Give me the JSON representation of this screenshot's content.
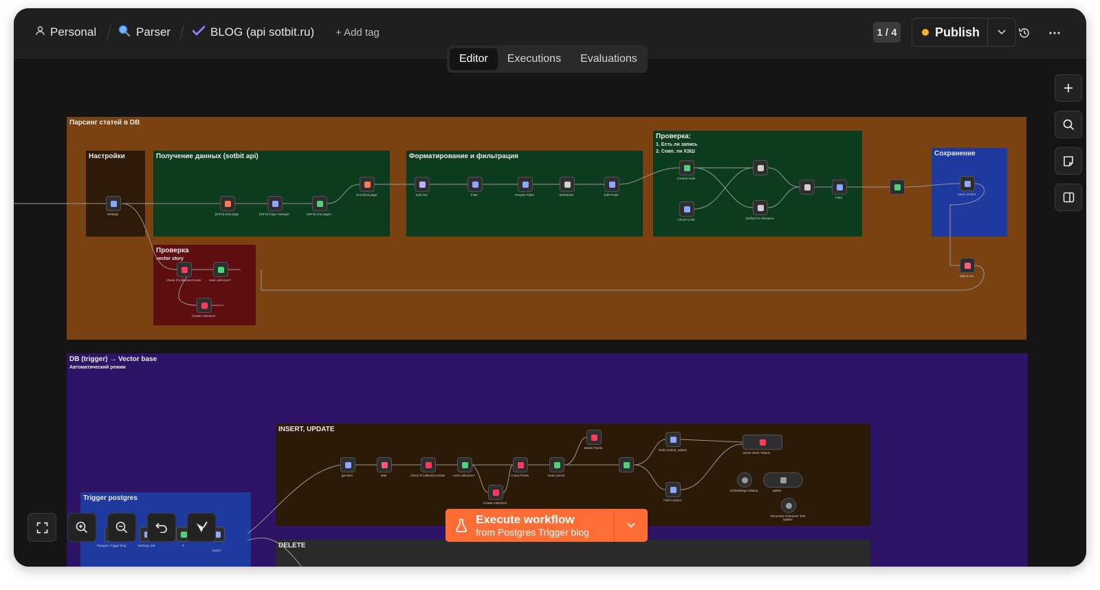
{
  "header": {
    "project": "Personal",
    "folder": "Parser",
    "workflow_name": "BLOG (api sotbit.ru)",
    "add_tag": "+ Add tag",
    "version_counter": "1 / 4",
    "publish_label": "Publish"
  },
  "tabs": [
    "Editor",
    "Executions",
    "Evaluations"
  ],
  "groups": {
    "parsing": {
      "title": "Парсинг статей в DB"
    },
    "settings": {
      "title": "Настройки"
    },
    "fetch": {
      "title": "Получение данных (sotbit api)"
    },
    "format": {
      "title": "Форматирование и фильтрация"
    },
    "check": {
      "title": "Проверка:",
      "line1": "1. Есть ли запись",
      "line2": "2. Совп. ли ХЭШ"
    },
    "save": {
      "title": "Сохранение"
    },
    "check2": {
      "title": "Проверка",
      "subtitle": "vector story"
    },
    "vector": {
      "title": "DB (trigger) → Vector base",
      "subtitle": "Автоматический режим"
    },
    "insert": {
      "title": "INSERT, UPDATE"
    },
    "trigger": {
      "title": "Trigger postgres"
    },
    "delete": {
      "title": "DELETE"
    }
  },
  "nodes": {
    "settings": "Settings",
    "total_page": "[INFO] total page",
    "page_manager": "[INFO] Page manager",
    "all_end_pages": "[INFO] end pages",
    "get_block": "Get block page",
    "split_out": "Split Out",
    "filter": "Filter",
    "prepare_table": "Prepare Table",
    "markdown": "Markdown",
    "edit_fields": "Edit Fields",
    "content_hash": "Content hash",
    "check_db": "Check in DB",
    "need_update": "Требуется обновить",
    "filter2": "Filter",
    "save_content": "Save content",
    "wait": "Wait & set",
    "check_collection": "Check if Collection Exists",
    "exist_collection": "exist collection?",
    "create_collection": "Create Collection",
    "get_item": "get item",
    "wait2": "Wait",
    "check_collection2": "Check if Collection Exists",
    "exist_collection2": "exist collection?",
    "create_collection2": "Create Collection",
    "count_points": "Count Points",
    "insert_points": "Insert points",
    "delete_points": "Delete Points",
    "field_content_added": "Field content_added",
    "field_content": "Field content",
    "vector_store": "Vector Store Tokens",
    "embeddings": "Embeddings Ollama",
    "splitter": "splitter",
    "recursive_splitter": "Recursive Character Text Splitter",
    "postgres_trigger": "Postgres Trigger blog",
    "settings_db": "Settings_DB",
    "if_node": "If",
    "switch_node": "Switch"
  },
  "execute": {
    "label": "Execute workflow",
    "sublabel": "from Postgres Trigger blog"
  },
  "colors": {
    "group_orange": "#7a4211",
    "group_green": "#0d3b1d",
    "group_blue": "#1f3a9e",
    "group_maroon": "#5e0d10",
    "group_purple": "#2e1466",
    "group_brown": "#2b1a08",
    "accent": "#ff6d37"
  }
}
